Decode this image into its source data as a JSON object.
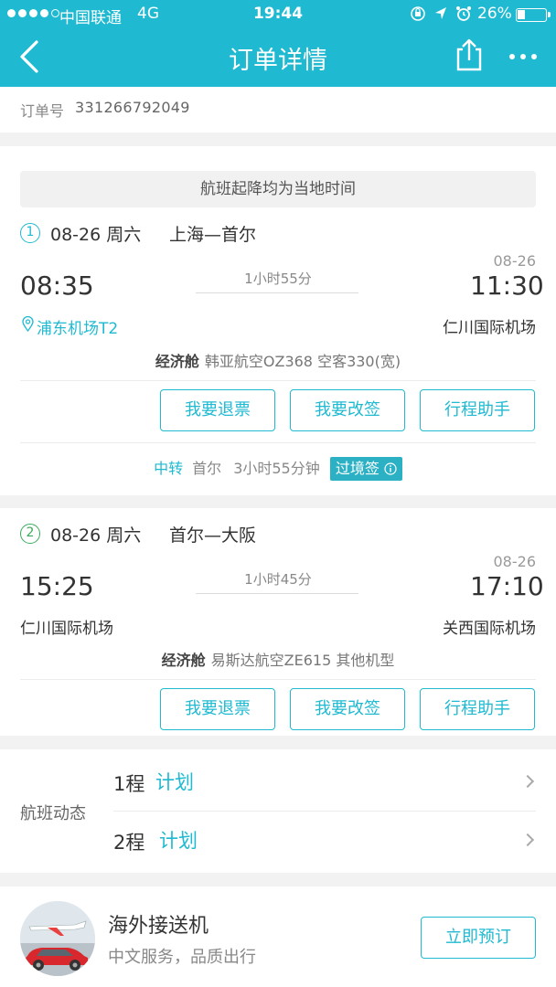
{
  "status_bar": {
    "carrier": "中国联通",
    "network": "4G",
    "time": "19:44",
    "battery": "26%",
    "battery_level": 0.26
  },
  "nav": {
    "title": "订单详情",
    "icons": [
      "back-icon",
      "share-icon",
      "more-icon"
    ]
  },
  "order": {
    "label": "订单号",
    "number": "331266792049"
  },
  "notice": "航班起降均为当地时间",
  "segments": [
    {
      "index": "1",
      "date": "08-26 周六",
      "route": "上海—首尔",
      "dep_time": "08:35",
      "arr_time": "11:30",
      "arr_date": "08-26",
      "duration": "1小时55分",
      "dep_airport": "浦东机场T2",
      "arr_airport": "仁川国际机场",
      "cabin": "经济舱",
      "flight": "韩亚航空OZ368  空客330(宽)"
    },
    {
      "index": "2",
      "date": "08-26 周六",
      "route": "首尔—大阪",
      "dep_time": "15:25",
      "arr_time": "17:10",
      "arr_date": "08-26",
      "duration": "1小时45分",
      "dep_airport": "仁川国际机场",
      "arr_airport": "关西国际机场",
      "cabin": "经济舱",
      "flight": "易斯达航空ZE615  其他机型"
    }
  ],
  "actions": {
    "refund": "我要退票",
    "change": "我要改签",
    "assistant": "行程助手"
  },
  "transfer": {
    "label": "中转",
    "city": "首尔",
    "duration": "3小时55分钟",
    "visa": "过境签"
  },
  "dynamics": {
    "label": "航班动态",
    "rows": [
      {
        "leg": "1程",
        "status": "计划"
      },
      {
        "leg": "2程",
        "status": "计划"
      }
    ]
  },
  "promo": {
    "title": "海外接送机",
    "subtitle": "中文服务，品质出行",
    "button": "立即预订"
  },
  "colors": {
    "accent": "#1fbad1",
    "green": "#3aaa5a",
    "background": "#f2f2f2"
  }
}
